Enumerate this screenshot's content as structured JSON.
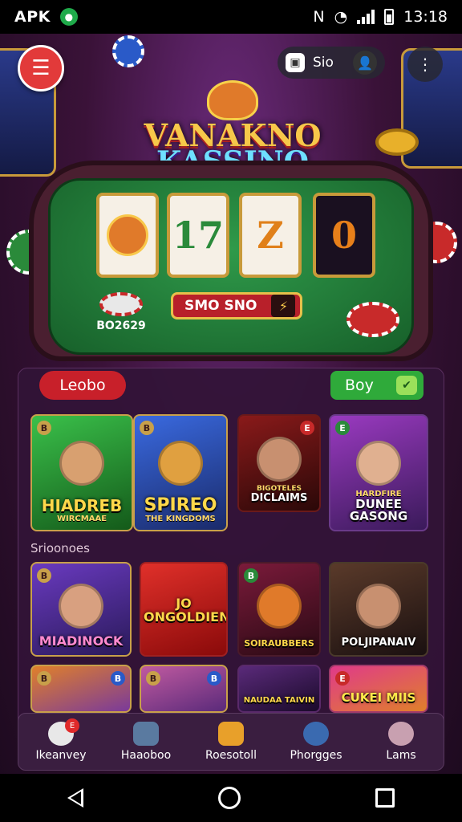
{
  "status_bar": {
    "left_label": "APK",
    "time": "13:18"
  },
  "header": {
    "search_text": "Sio"
  },
  "title": {
    "line1": "VANAKNO",
    "line2": "KASSINO"
  },
  "slot": {
    "reels": [
      "",
      "17",
      "Z",
      "0"
    ],
    "spin_label": "SMO SNO",
    "balance_label": "BO2629"
  },
  "tabs": {
    "left_label": "Leobo",
    "right_label": "Boy"
  },
  "featured_games": [
    {
      "name": "HIADREB",
      "sub": "WIRCMAAE",
      "bg": "#2a8a3a"
    },
    {
      "name": "SPIREO",
      "sub": "THE KINGDOMS",
      "bg": "#2a4aa0"
    },
    {
      "name": "DICLAIMS",
      "sub": "BIGOTELES",
      "bg": "#6a1a1a"
    },
    {
      "name": "DUNEE GASONG",
      "sub": "HARDFIRE",
      "bg": "#7a2a9a"
    }
  ],
  "section_label": "Srioonoes",
  "games_row2": [
    {
      "name": "MIADINOCK",
      "bg": "#4a2a8a"
    },
    {
      "name": "JO ONGOLDIENS",
      "bg": "#c81a1a"
    },
    {
      "name": "SOIRAUBBERS",
      "bg": "#5a1a30"
    },
    {
      "name": "POLJIPANAIV",
      "bg": "#3a2a2a"
    }
  ],
  "games_row3": [
    {
      "name": "",
      "bg": "#7a3a9a"
    },
    {
      "name": "",
      "bg": "#8a3aa0"
    },
    {
      "name": "NAUDAA TAIVIN",
      "bg": "#3a1a4a"
    },
    {
      "name": "CUKEI MIIS",
      "bg": "#a02a60"
    }
  ],
  "bottom_nav": [
    {
      "label": "Ikeanvey",
      "color": "#e8e8e8",
      "badge": "E"
    },
    {
      "label": "Haaoboo",
      "color": "#5a7aa0",
      "badge": ""
    },
    {
      "label": "Roesotoll",
      "color": "#e8a02a",
      "badge": ""
    },
    {
      "label": "Phorgges",
      "color": "#3a6ab0",
      "badge": ""
    },
    {
      "label": "Lams",
      "color": "#c8a0b0",
      "badge": ""
    }
  ]
}
